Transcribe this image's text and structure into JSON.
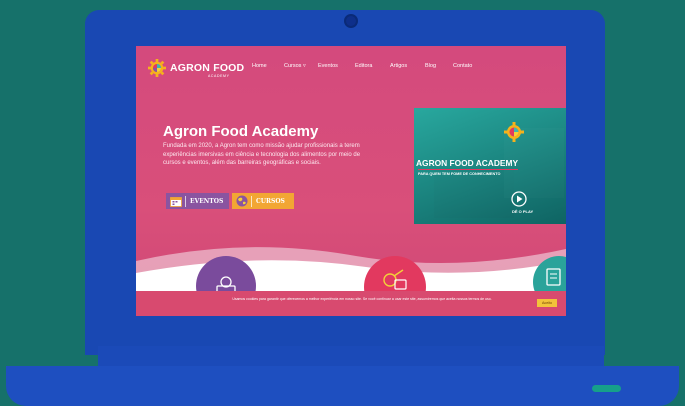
{
  "colors": {
    "background": "#16716a",
    "laptop": "#1948b3",
    "hero": "#d64a7c",
    "eventos_button": "#8a54a0",
    "cursos_button": "#f2a634",
    "cookie_accept": "#f2c33a"
  },
  "brand": {
    "name": "AGRON FOOD",
    "tagline": "ACADEMY"
  },
  "nav": {
    "items": [
      {
        "label": "Home"
      },
      {
        "label": "Cursos ▿"
      },
      {
        "label": "Eventos"
      },
      {
        "label": "Editora"
      },
      {
        "label": "Artigos"
      },
      {
        "label": "Blog"
      },
      {
        "label": "Contato"
      }
    ]
  },
  "hero": {
    "title": "Agron Food Academy",
    "description": "Fundada em 2020, a Agron tem como missão ajudar profissionais a terem experiências imersivas em ciência e tecnologia dos alimentos por meio de cursos e eventos, além das barreiras geográficas e sociais.",
    "buttons": {
      "eventos": "EVENTOS",
      "cursos": "CURSOS"
    }
  },
  "video": {
    "title": "AGRON FOOD ACADEMY",
    "subtitle": "PARA QUEM TEM FOME DE CONHECIMENTO",
    "play_label": "DÊ O PLAY"
  },
  "cookie": {
    "text": "Usamos cookies para garantir que oferecemos a melhor experiência em nosso site. Se você continuar a usar este site, assumiremos que aceita nossos termos de uso.",
    "accept": "Aceito"
  },
  "icons": {
    "logo": "gear-icon",
    "eventos": "calendar-icon",
    "cursos": "globe-icon",
    "play": "play-icon",
    "feature_left": "laptop-person-icon",
    "feature_center": "guitar-icon",
    "feature_right": "document-icon"
  }
}
